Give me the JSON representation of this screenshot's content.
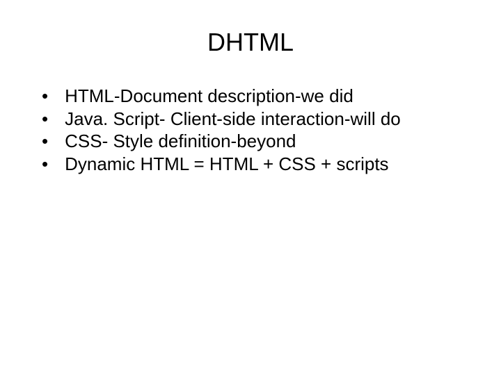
{
  "slide": {
    "title": "DHTML",
    "bullets": [
      "HTML-Document description-we did",
      "Java. Script- Client-side interaction-will do",
      "CSS- Style definition-beyond",
      "Dynamic HTML = HTML + CSS + scripts"
    ]
  }
}
